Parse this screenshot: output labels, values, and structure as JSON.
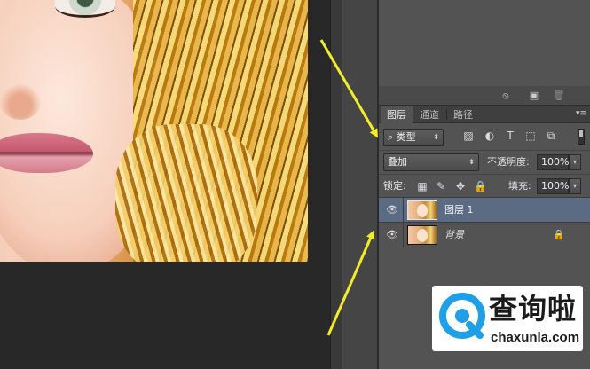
{
  "colors": {
    "panel_bg": "#535353",
    "selected_layer": "#5b6b84",
    "arrow": "#f2ec2a",
    "watermark_accent": "#1f9fe6"
  },
  "top_footer": {
    "icons": [
      "no-entry-icon",
      "new-item-icon",
      "trash-icon"
    ]
  },
  "tabs": [
    {
      "label": "图层",
      "active": true
    },
    {
      "label": "通道",
      "active": false
    },
    {
      "label": "路径",
      "active": false
    }
  ],
  "filter": {
    "search_glyph": "⌕",
    "kind_label": "类型",
    "icons": [
      "image-filter-icon",
      "adjustment-filter-icon",
      "type-filter-icon",
      "shape-filter-icon",
      "smart-object-filter-icon"
    ]
  },
  "blend": {
    "mode": "叠加",
    "opacity_label": "不透明度:",
    "opacity_value": "100%"
  },
  "lock": {
    "label": "锁定:",
    "icons": [
      "lock-transparent-icon",
      "lock-image-icon",
      "lock-position-icon",
      "lock-all-icon"
    ],
    "fill_label": "填充:",
    "fill_value": "100%"
  },
  "layers": [
    {
      "name": "图层 1",
      "selected": true,
      "visible": true,
      "locked": false,
      "italic": false
    },
    {
      "name": "背景",
      "selected": false,
      "visible": true,
      "locked": true,
      "italic": true
    }
  ],
  "watermark": {
    "cn": "查询啦",
    "en": "chaxunla.com"
  }
}
